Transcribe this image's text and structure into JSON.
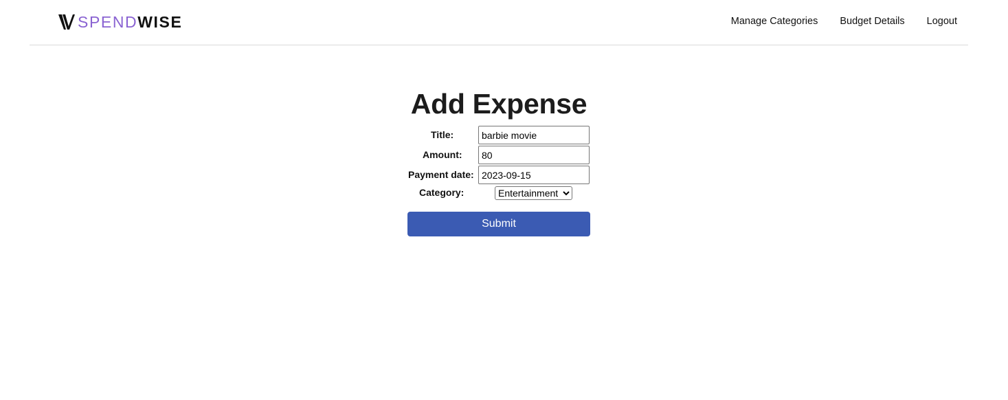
{
  "brand": {
    "part1": "SPEND",
    "part2": "WISE",
    "logo_icon": "w-logo-icon",
    "accent_color": "#8a63d2"
  },
  "nav": {
    "items": [
      "Manage Categories",
      "Budget Details",
      "Logout"
    ]
  },
  "form": {
    "heading": "Add Expense",
    "title_label": "Title:",
    "title_value": "barbie movie",
    "amount_label": "Amount:",
    "amount_value": "80",
    "date_label": "Payment date:",
    "date_value": "2023-09-15",
    "category_label": "Category:",
    "category_value": "Entertainment",
    "submit_label": "Submit",
    "submit_color": "#3b5bb3"
  }
}
